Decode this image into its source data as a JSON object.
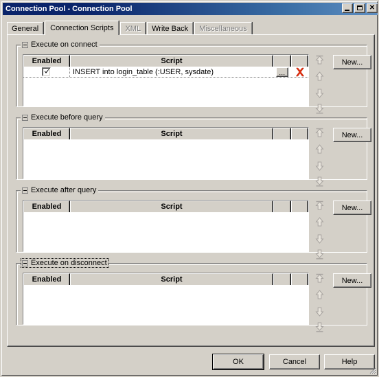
{
  "window": {
    "title": "Connection Pool - Connection Pool",
    "controls": {
      "minimize": "Minimize",
      "maximize": "Maximize",
      "close": "Close"
    }
  },
  "tabs": [
    {
      "label": "General",
      "selected": false,
      "disabled": false
    },
    {
      "label": "Connection Scripts",
      "selected": true,
      "disabled": false
    },
    {
      "label": "XML",
      "selected": false,
      "disabled": true
    },
    {
      "label": "Write Back",
      "selected": false,
      "disabled": false
    },
    {
      "label": "Miscellaneous",
      "selected": false,
      "disabled": true
    }
  ],
  "columns": {
    "enabled": "Enabled",
    "script": "Script"
  },
  "row_buttons": {
    "ellipsis": "...",
    "delete_icon": "red-x-delete-icon"
  },
  "arrow_buttons": [
    {
      "name": "move-to-top-button",
      "icon": "double-up-arrow-icon"
    },
    {
      "name": "move-up-button",
      "icon": "up-arrow-icon"
    },
    {
      "name": "move-down-button",
      "icon": "down-arrow-icon"
    },
    {
      "name": "move-to-bottom-button",
      "icon": "double-down-arrow-icon"
    }
  ],
  "groups": [
    {
      "caption": "Execute on connect",
      "focused": false,
      "new_label": "New...",
      "rows": [
        {
          "enabled": true,
          "script": "INSERT into login_table (:USER, sysdate)"
        }
      ]
    },
    {
      "caption": "Execute before query",
      "focused": false,
      "new_label": "New...",
      "rows": []
    },
    {
      "caption": "Execute after query",
      "focused": false,
      "new_label": "New...",
      "rows": []
    },
    {
      "caption": "Execute on disconnect",
      "focused": true,
      "new_label": "New...",
      "rows": []
    }
  ],
  "footer": {
    "ok": "OK",
    "cancel": "Cancel",
    "help": "Help"
  },
  "colors": {
    "dialog_face": "#d4d0c8",
    "titlebar_start": "#0a246a",
    "titlebar_end": "#5f8fc2",
    "titlebar_text": "#ffffff",
    "disabled_text": "#808080",
    "grid_background": "#ffffff",
    "delete_icon": "#e03010"
  }
}
